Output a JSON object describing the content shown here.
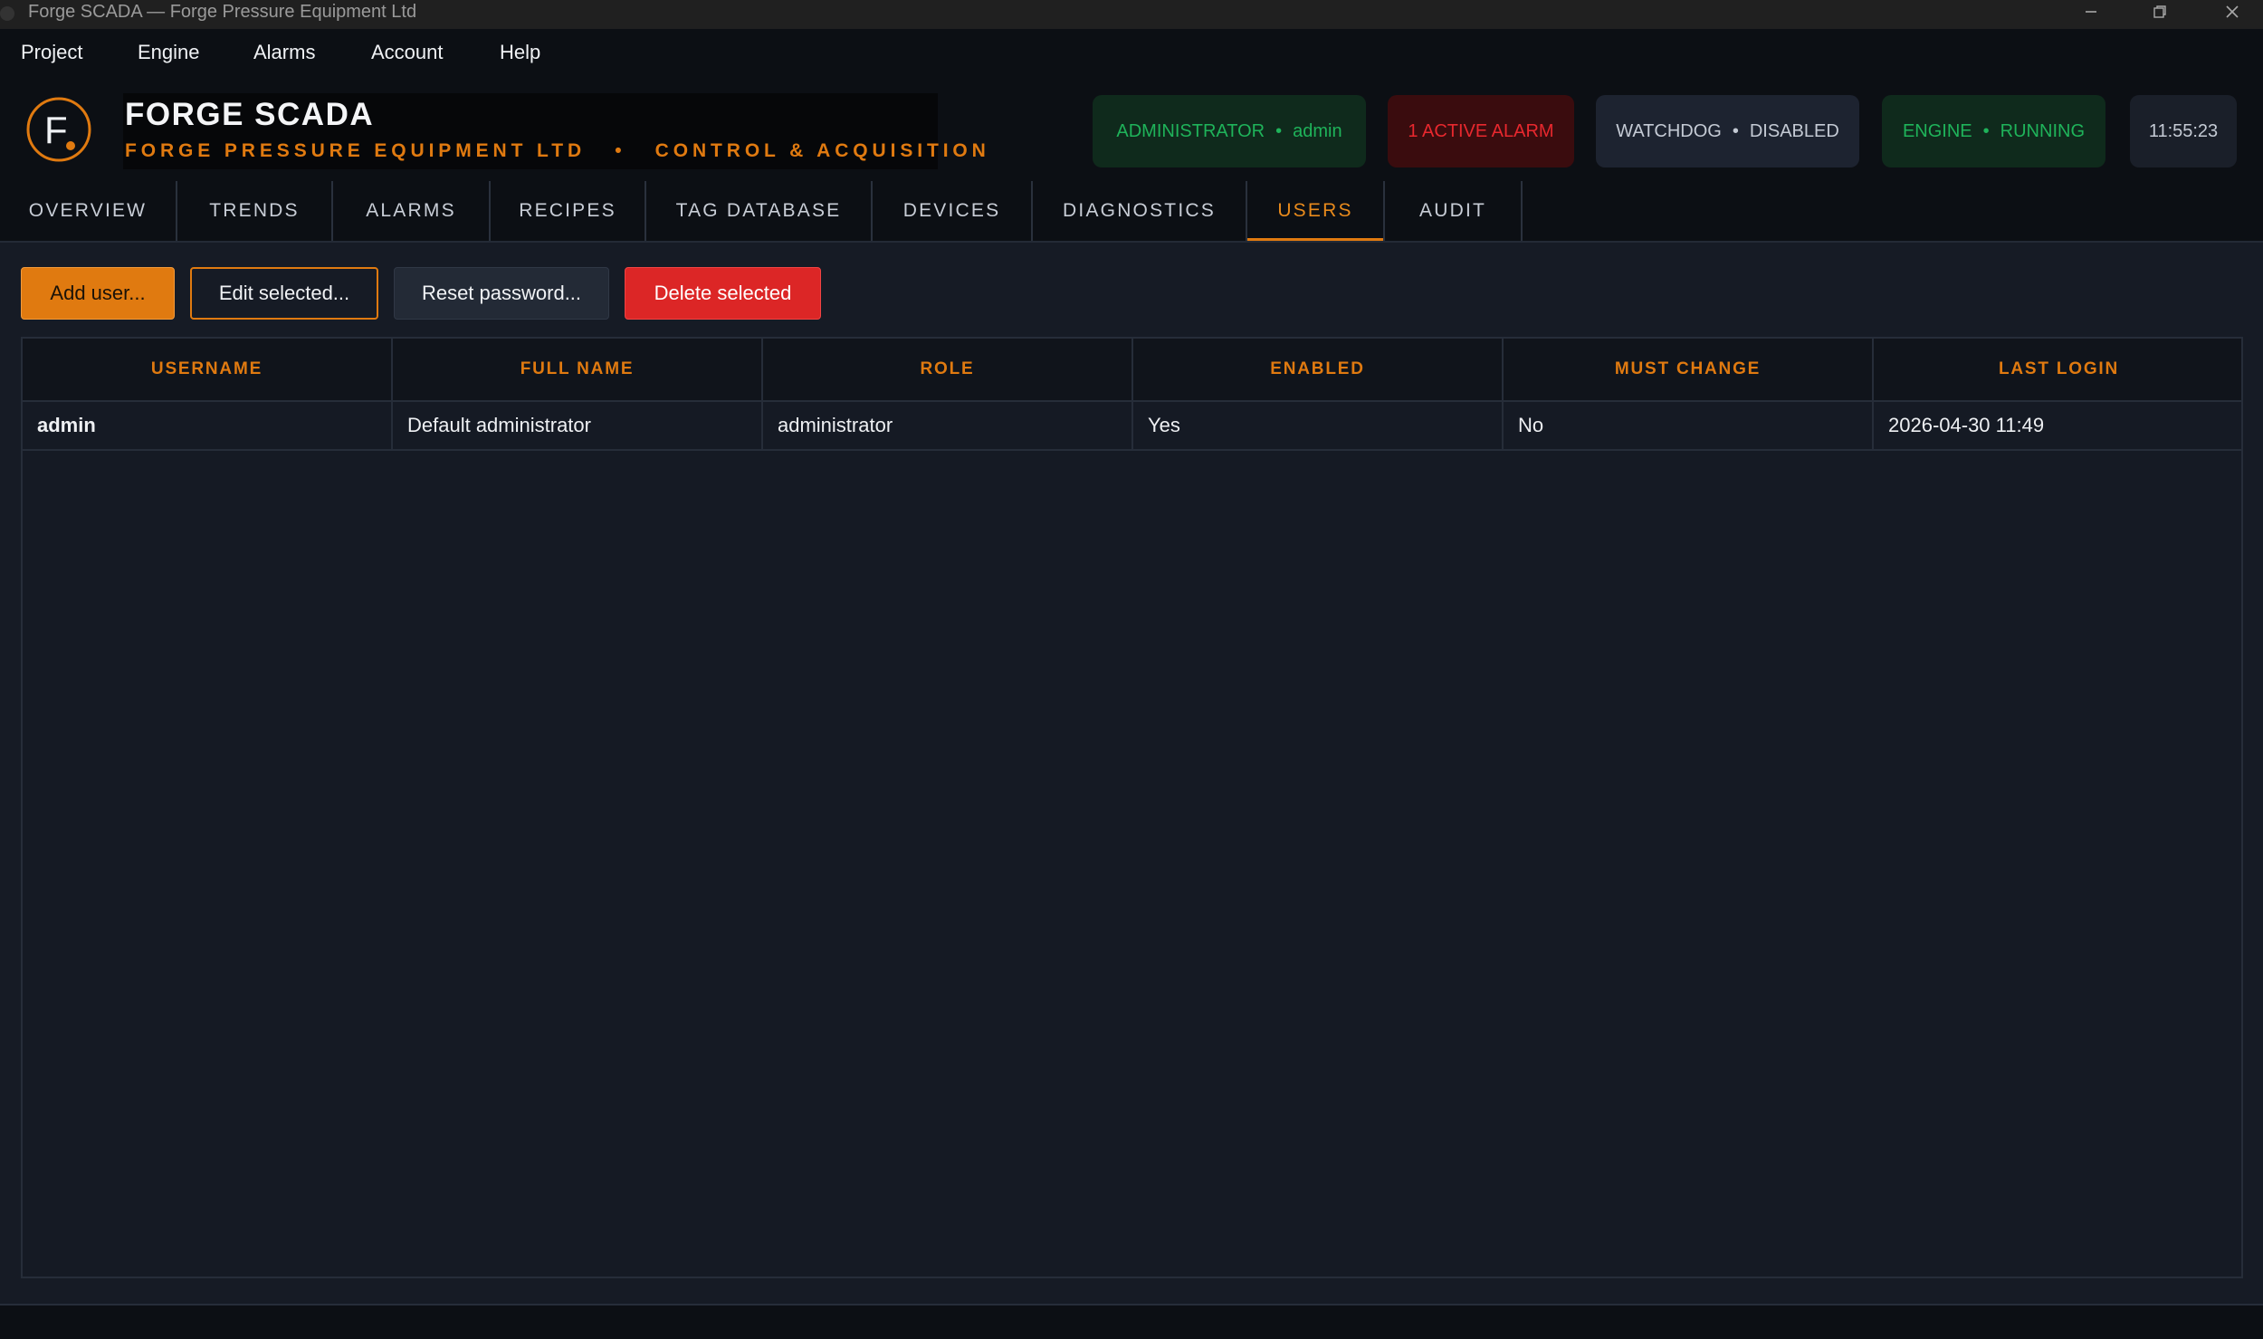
{
  "window": {
    "title": "Forge SCADA — Forge Pressure Equipment Ltd"
  },
  "menu": [
    "Project",
    "Engine",
    "Alarms",
    "Account",
    "Help"
  ],
  "brand": {
    "logo_letter": "F",
    "title": "FORGE SCADA",
    "subtitle": "FORGE PRESSURE EQUIPMENT LTD   •   CONTROL & ACQUISITION"
  },
  "status": {
    "user_role": "ADMINISTRATOR",
    "user_name": "admin",
    "alarm": "1 ACTIVE ALARM",
    "watchdog_label": "WATCHDOG",
    "watchdog_state": "DISABLED",
    "engine_label": "ENGINE",
    "engine_state": "RUNNING",
    "separator": "•",
    "clock": "11:55:23"
  },
  "tabs": [
    "OVERVIEW",
    "TRENDS",
    "ALARMS",
    "RECIPES",
    "TAG DATABASE",
    "DEVICES",
    "DIAGNOSTICS",
    "USERS",
    "AUDIT"
  ],
  "active_tab": "USERS",
  "toolbar": {
    "add": "Add user...",
    "edit": "Edit selected...",
    "reset": "Reset password...",
    "delete": "Delete selected"
  },
  "table": {
    "columns": [
      "USERNAME",
      "FULL NAME",
      "ROLE",
      "ENABLED",
      "MUST CHANGE",
      "LAST LOGIN"
    ],
    "rows": [
      [
        "admin",
        "Default administrator",
        "administrator",
        "Yes",
        "No",
        "2026-04-30 11:49"
      ]
    ]
  },
  "colors": {
    "accent": "#e07a10",
    "ok": "#1fb35a",
    "alarm": "#e8282e",
    "danger": "#dc2626",
    "background": "#161b25"
  },
  "icons": [
    "app-icon",
    "minimize-icon",
    "restore-icon",
    "close-icon",
    "forge-logo-icon"
  ]
}
